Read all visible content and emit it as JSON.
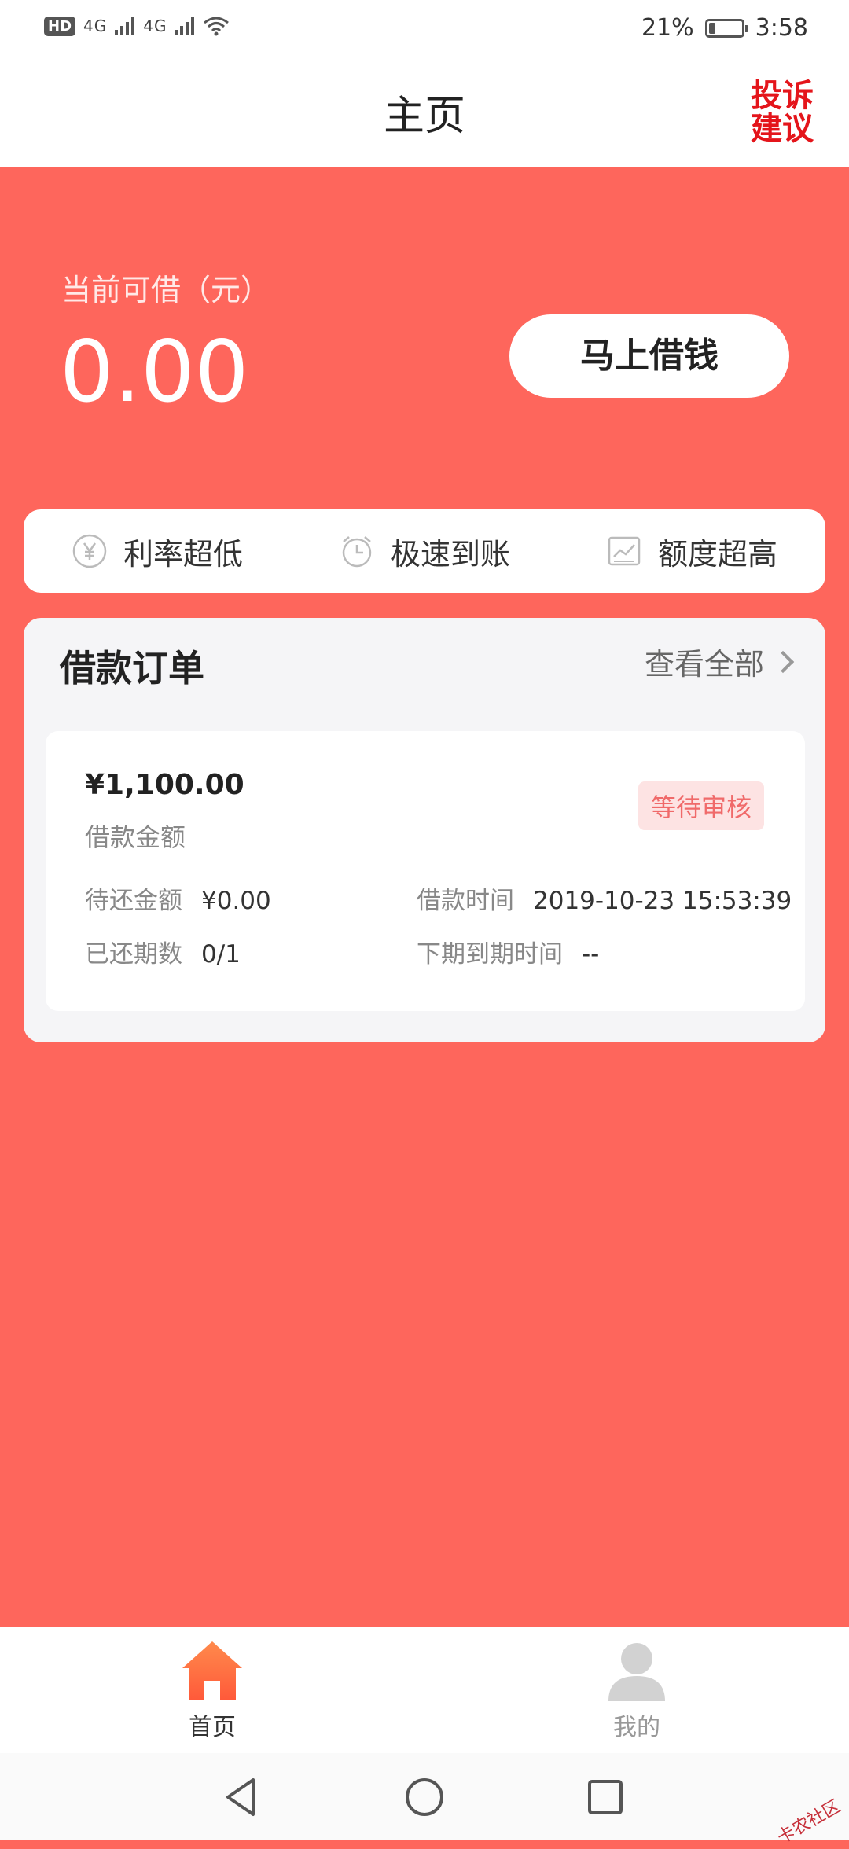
{
  "status_bar": {
    "hd": "HD",
    "signal_1": "4G",
    "signal_2": "4G",
    "battery_percent": "21%",
    "battery_level": 0.21,
    "time": "3:58"
  },
  "header": {
    "title": "主页",
    "complaint_label": "投诉建议"
  },
  "available": {
    "label": "当前可借（元）",
    "amount": "0.00",
    "borrow_button": "马上借钱"
  },
  "features": [
    {
      "icon": "yen-circle-icon",
      "label": "利率超低"
    },
    {
      "icon": "alarm-clock-icon",
      "label": "极速到账"
    },
    {
      "icon": "chart-line-icon",
      "label": "额度超高"
    }
  ],
  "orders": {
    "title": "借款订单",
    "view_all": "查看全部",
    "items": [
      {
        "amount": "¥1,100.00",
        "amount_label": "借款金额",
        "status": "等待审核",
        "pending_label": "待还金额",
        "pending_value": "¥0.00",
        "time_label": "借款时间",
        "time_value": "2019-10-23 15:53:39",
        "periods_label": "已还期数",
        "periods_value": "0/1",
        "next_due_label": "下期到期时间",
        "next_due_value": "--"
      }
    ]
  },
  "tabbar": {
    "home_label": "首页",
    "mine_label": "我的"
  },
  "watermark": "卡农社区",
  "colors": {
    "background": "#fe665c",
    "complaint_red": "#e4151b",
    "status_pink": "#fde3e3",
    "home_icon_orange": "#ff6a3d"
  }
}
